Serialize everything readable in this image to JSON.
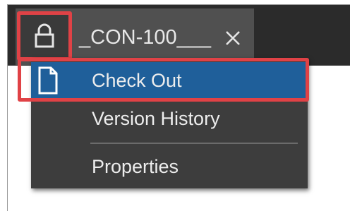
{
  "tab": {
    "title": "_CON-100___",
    "lock_icon": "lock-icon",
    "close_icon": "close-icon"
  },
  "menu": {
    "items": [
      {
        "label": "Check Out",
        "icon": "document-icon",
        "highlighted": true
      },
      {
        "label": "Version History",
        "icon": "",
        "highlighted": false
      },
      {
        "label": "Properties",
        "icon": "",
        "highlighted": false
      }
    ]
  },
  "colors": {
    "highlight": "#1f5f9a",
    "callout": "#e04246",
    "menu_bg": "#3d3d3d",
    "tab_bg": "#505050"
  }
}
